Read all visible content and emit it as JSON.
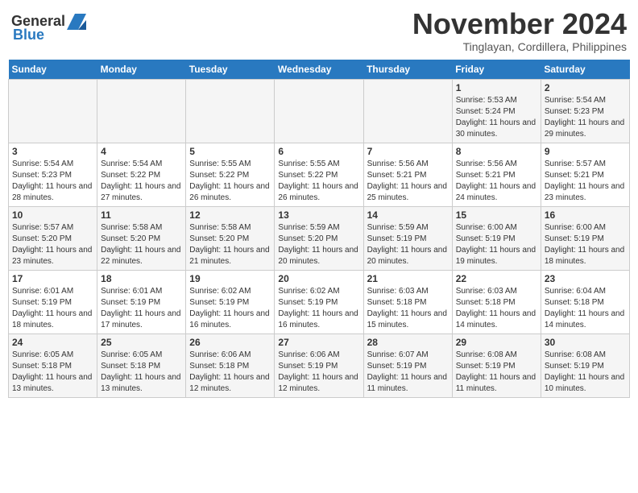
{
  "header": {
    "logo": {
      "general": "General",
      "blue": "Blue"
    },
    "month_year": "November 2024",
    "location": "Tinglayan, Cordillera, Philippines"
  },
  "weekdays": [
    "Sunday",
    "Monday",
    "Tuesday",
    "Wednesday",
    "Thursday",
    "Friday",
    "Saturday"
  ],
  "weeks": [
    [
      {
        "day": "",
        "info": ""
      },
      {
        "day": "",
        "info": ""
      },
      {
        "day": "",
        "info": ""
      },
      {
        "day": "",
        "info": ""
      },
      {
        "day": "",
        "info": ""
      },
      {
        "day": "1",
        "info": "Sunrise: 5:53 AM\nSunset: 5:24 PM\nDaylight: 11 hours and 30 minutes."
      },
      {
        "day": "2",
        "info": "Sunrise: 5:54 AM\nSunset: 5:23 PM\nDaylight: 11 hours and 29 minutes."
      }
    ],
    [
      {
        "day": "3",
        "info": "Sunrise: 5:54 AM\nSunset: 5:23 PM\nDaylight: 11 hours and 28 minutes."
      },
      {
        "day": "4",
        "info": "Sunrise: 5:54 AM\nSunset: 5:22 PM\nDaylight: 11 hours and 27 minutes."
      },
      {
        "day": "5",
        "info": "Sunrise: 5:55 AM\nSunset: 5:22 PM\nDaylight: 11 hours and 26 minutes."
      },
      {
        "day": "6",
        "info": "Sunrise: 5:55 AM\nSunset: 5:22 PM\nDaylight: 11 hours and 26 minutes."
      },
      {
        "day": "7",
        "info": "Sunrise: 5:56 AM\nSunset: 5:21 PM\nDaylight: 11 hours and 25 minutes."
      },
      {
        "day": "8",
        "info": "Sunrise: 5:56 AM\nSunset: 5:21 PM\nDaylight: 11 hours and 24 minutes."
      },
      {
        "day": "9",
        "info": "Sunrise: 5:57 AM\nSunset: 5:21 PM\nDaylight: 11 hours and 23 minutes."
      }
    ],
    [
      {
        "day": "10",
        "info": "Sunrise: 5:57 AM\nSunset: 5:20 PM\nDaylight: 11 hours and 23 minutes."
      },
      {
        "day": "11",
        "info": "Sunrise: 5:58 AM\nSunset: 5:20 PM\nDaylight: 11 hours and 22 minutes."
      },
      {
        "day": "12",
        "info": "Sunrise: 5:58 AM\nSunset: 5:20 PM\nDaylight: 11 hours and 21 minutes."
      },
      {
        "day": "13",
        "info": "Sunrise: 5:59 AM\nSunset: 5:20 PM\nDaylight: 11 hours and 20 minutes."
      },
      {
        "day": "14",
        "info": "Sunrise: 5:59 AM\nSunset: 5:19 PM\nDaylight: 11 hours and 20 minutes."
      },
      {
        "day": "15",
        "info": "Sunrise: 6:00 AM\nSunset: 5:19 PM\nDaylight: 11 hours and 19 minutes."
      },
      {
        "day": "16",
        "info": "Sunrise: 6:00 AM\nSunset: 5:19 PM\nDaylight: 11 hours and 18 minutes."
      }
    ],
    [
      {
        "day": "17",
        "info": "Sunrise: 6:01 AM\nSunset: 5:19 PM\nDaylight: 11 hours and 18 minutes."
      },
      {
        "day": "18",
        "info": "Sunrise: 6:01 AM\nSunset: 5:19 PM\nDaylight: 11 hours and 17 minutes."
      },
      {
        "day": "19",
        "info": "Sunrise: 6:02 AM\nSunset: 5:19 PM\nDaylight: 11 hours and 16 minutes."
      },
      {
        "day": "20",
        "info": "Sunrise: 6:02 AM\nSunset: 5:19 PM\nDaylight: 11 hours and 16 minutes."
      },
      {
        "day": "21",
        "info": "Sunrise: 6:03 AM\nSunset: 5:18 PM\nDaylight: 11 hours and 15 minutes."
      },
      {
        "day": "22",
        "info": "Sunrise: 6:03 AM\nSunset: 5:18 PM\nDaylight: 11 hours and 14 minutes."
      },
      {
        "day": "23",
        "info": "Sunrise: 6:04 AM\nSunset: 5:18 PM\nDaylight: 11 hours and 14 minutes."
      }
    ],
    [
      {
        "day": "24",
        "info": "Sunrise: 6:05 AM\nSunset: 5:18 PM\nDaylight: 11 hours and 13 minutes."
      },
      {
        "day": "25",
        "info": "Sunrise: 6:05 AM\nSunset: 5:18 PM\nDaylight: 11 hours and 13 minutes."
      },
      {
        "day": "26",
        "info": "Sunrise: 6:06 AM\nSunset: 5:18 PM\nDaylight: 11 hours and 12 minutes."
      },
      {
        "day": "27",
        "info": "Sunrise: 6:06 AM\nSunset: 5:19 PM\nDaylight: 11 hours and 12 minutes."
      },
      {
        "day": "28",
        "info": "Sunrise: 6:07 AM\nSunset: 5:19 PM\nDaylight: 11 hours and 11 minutes."
      },
      {
        "day": "29",
        "info": "Sunrise: 6:08 AM\nSunset: 5:19 PM\nDaylight: 11 hours and 11 minutes."
      },
      {
        "day": "30",
        "info": "Sunrise: 6:08 AM\nSunset: 5:19 PM\nDaylight: 11 hours and 10 minutes."
      }
    ]
  ]
}
